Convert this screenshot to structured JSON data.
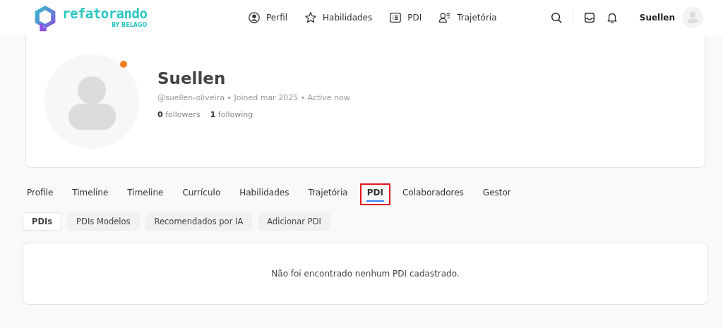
{
  "header": {
    "logo": {
      "name": "refatorando",
      "tagline": "BY BELAGO"
    },
    "nav": [
      {
        "label": "Perfil",
        "kind": "profile"
      },
      {
        "label": "Habilidades",
        "kind": "star"
      },
      {
        "label": "PDI",
        "kind": "list"
      },
      {
        "label": "Trajetória",
        "kind": "path"
      }
    ],
    "user_name": "Suellen"
  },
  "profile": {
    "name": "Suellen",
    "online": true,
    "meta": "@suellen-oliveira • Joined mar 2025 • Active now",
    "followers": {
      "count": "0",
      "label": "followers"
    },
    "following": {
      "count": "1",
      "label": "following"
    }
  },
  "tabs": [
    {
      "label": "Profile",
      "selected": false,
      "highlighted": false
    },
    {
      "label": "Timeline",
      "selected": false,
      "highlighted": false
    },
    {
      "label": "Timeline",
      "selected": false,
      "highlighted": false
    },
    {
      "label": "Currículo",
      "selected": false,
      "highlighted": false
    },
    {
      "label": "Habilidades",
      "selected": false,
      "highlighted": false
    },
    {
      "label": "Trajetória",
      "selected": false,
      "highlighted": false
    },
    {
      "label": "PDI",
      "selected": true,
      "highlighted": true
    },
    {
      "label": "Colaboradores",
      "selected": false,
      "highlighted": false
    },
    {
      "label": "Gestor",
      "selected": false,
      "highlighted": false
    }
  ],
  "subtabs": [
    {
      "label": "PDIs",
      "selected": true
    },
    {
      "label": "PDIs Modelos",
      "selected": false
    },
    {
      "label": "Recomendados por IA",
      "selected": false
    },
    {
      "label": "Adicionar PDI",
      "selected": false
    }
  ],
  "empty_message": "Não foi encontrado nenhum PDI cadastrado."
}
